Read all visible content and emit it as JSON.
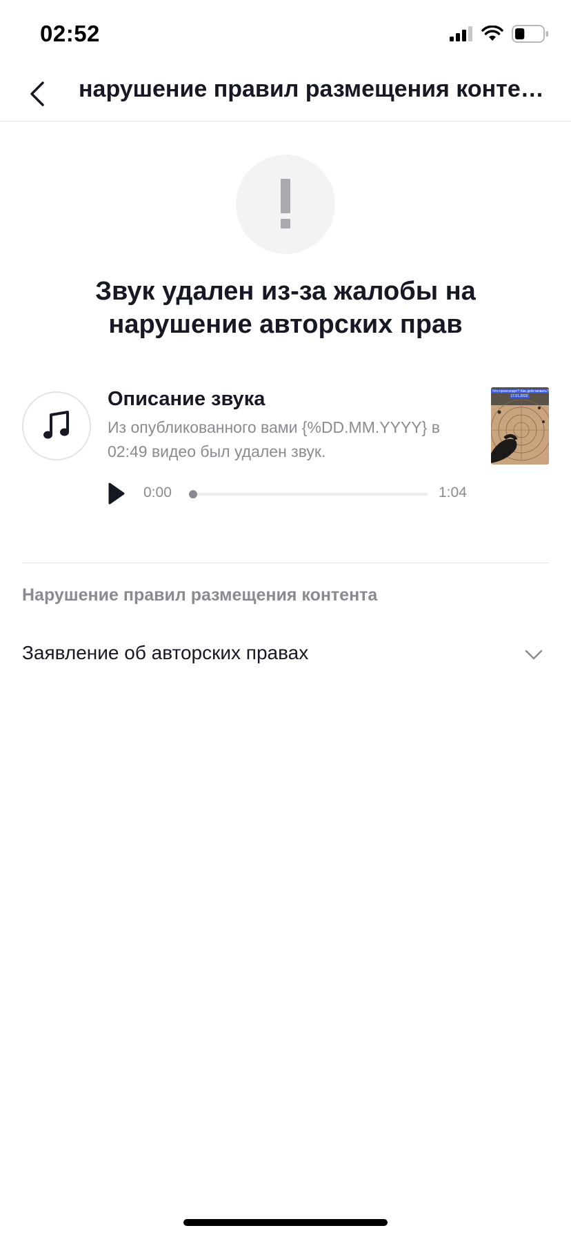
{
  "status_bar": {
    "time": "02:52",
    "battery_level": 0.35
  },
  "nav": {
    "title": "нарушение правил размещения контента"
  },
  "headline": "Звук удален из-за жалобы на нарушение авторских прав",
  "sound": {
    "title": "Описание звука",
    "description": "Из опубликованного вами {%DD.MM.YYYY} в 02:49 видео был удален звук.",
    "thumbnail_text": "Что происходит? Как действовать? 17.01.2022"
  },
  "player": {
    "current_time": "0:00",
    "total_time": "1:04",
    "progress": 0
  },
  "section": {
    "label": "Нарушение правил размещения контента",
    "dropdown_label": "Заявление об авторских правах"
  },
  "colors": {
    "primary_text": "#161823",
    "secondary_text": "#8a8b91",
    "divider": "#e3e3e4"
  }
}
